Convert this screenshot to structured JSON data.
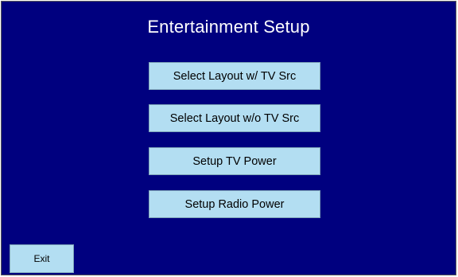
{
  "screen": {
    "title": "Entertainment Setup",
    "background_color": "#00007f",
    "button_color": "#b3def2"
  },
  "menu": {
    "items": [
      {
        "label": "Select Layout w/ TV Src"
      },
      {
        "label": "Select Layout w/o TV Src"
      },
      {
        "label": "Setup TV Power"
      },
      {
        "label": "Setup Radio Power"
      }
    ]
  },
  "footer": {
    "exit_label": "Exit"
  }
}
